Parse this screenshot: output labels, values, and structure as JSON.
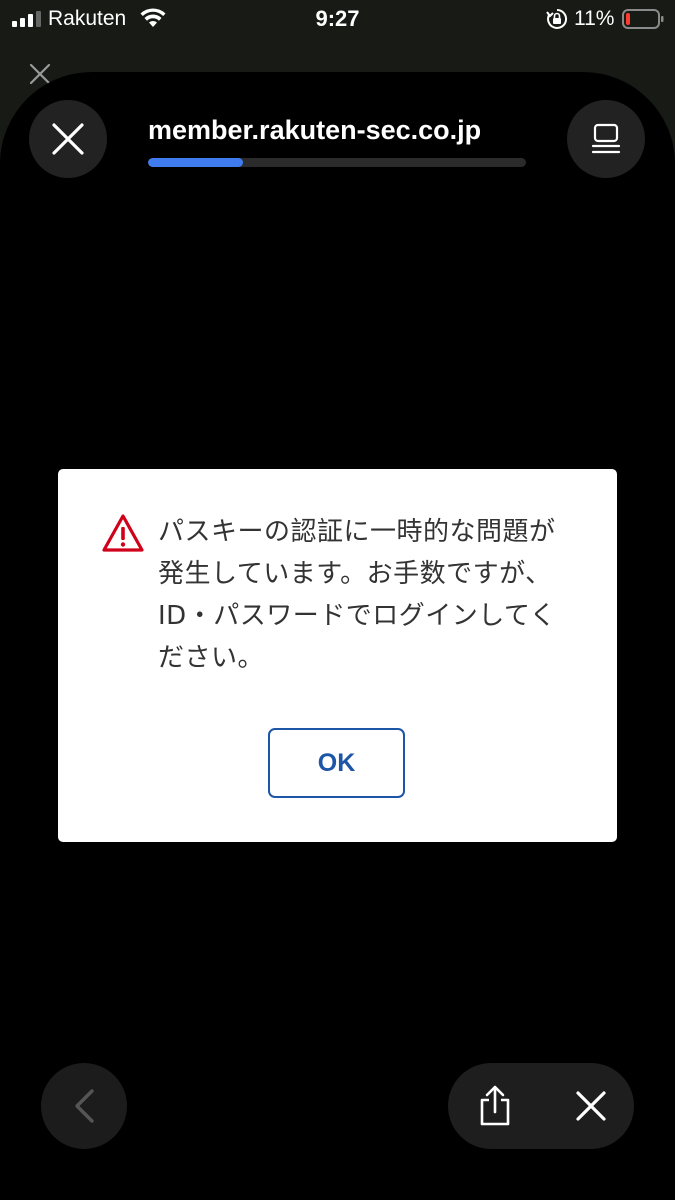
{
  "status_bar": {
    "carrier": "Rakuten",
    "time": "9:27",
    "battery_percent": "11%",
    "icons": [
      "signal-icon",
      "wifi-icon",
      "rotation-lock-icon",
      "battery-low-icon"
    ]
  },
  "browser": {
    "url": "member.rakuten-sec.co.jp",
    "load_progress": 0.25,
    "progress_color": "#3e7cf0",
    "icons": [
      "close-icon",
      "tabs-icon",
      "back-icon",
      "share-icon",
      "close-icon"
    ]
  },
  "dialog": {
    "message": "パスキーの認証に一時的な問題が発生しています。お手数ですが、ID・パスワードでログインしてください。",
    "ok_label": "OK",
    "warning_color": "#d0021b",
    "accent_color": "#1d55a7"
  }
}
